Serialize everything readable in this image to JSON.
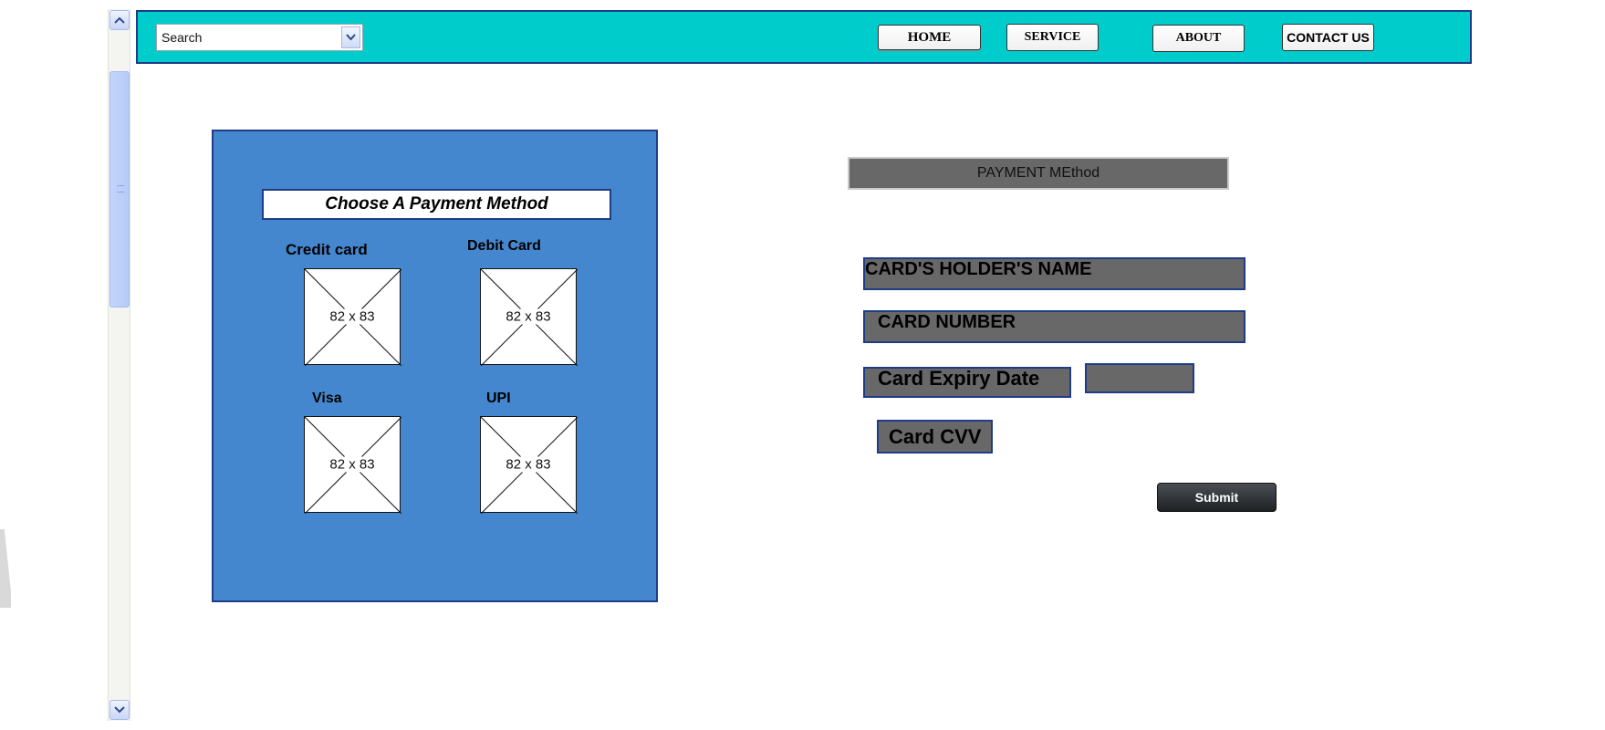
{
  "header": {
    "search_placeholder": "Search",
    "nav": {
      "home": "HOME",
      "service": "SERVICE",
      "about": "ABOUT",
      "contact": "CONTACT US"
    }
  },
  "panel": {
    "title": "Choose A Payment Method",
    "options": [
      {
        "label": "Credit card",
        "image_size": "82 x 83"
      },
      {
        "label": "Debit Card",
        "image_size": "82 x 83"
      },
      {
        "label": "Visa",
        "image_size": "82 x 83"
      },
      {
        "label": "UPI",
        "image_size": "82 x 83"
      }
    ]
  },
  "form": {
    "heading": "PAYMENT MEthod",
    "holder_name": "CARD'S HOLDER'S NAME",
    "card_number": "CARD NUMBER",
    "expiry": "Card Expiry Date",
    "cvv": "Card CVV",
    "submit": "Submit"
  },
  "colors": {
    "header_bg": "#00cccc",
    "panel_bg": "#4587cf",
    "border_navy": "#1f3c88",
    "field_grey": "#686868"
  }
}
